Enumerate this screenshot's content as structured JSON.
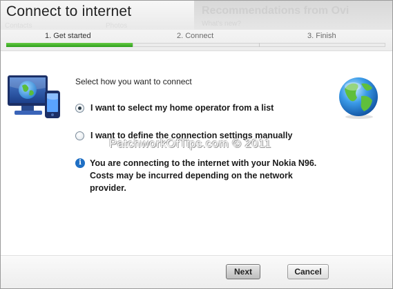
{
  "window": {
    "title": "Connect to internet",
    "background_title": "Recommendations from Ovi",
    "background_subtitle": "What's new?",
    "background_left_subtext_1": "Contacts",
    "background_left_subtext_2": "Photos"
  },
  "steps": {
    "items": [
      {
        "label": "1. Get started",
        "active": true
      },
      {
        "label": "2. Connect",
        "active": false
      },
      {
        "label": "3. Finish",
        "active": false
      }
    ],
    "progress_fraction": 0.333,
    "progress_color": "#3aaa2a"
  },
  "content": {
    "instruction": "Select how you want to connect",
    "options": [
      {
        "label": "I want to select my home operator from a list",
        "selected": true
      },
      {
        "label": "I want to define the connection settings manually",
        "selected": false
      }
    ],
    "info_icon": "info-icon",
    "info_text": "You are connecting to the internet with your Nokia N96. Costs may be incurred depending on the network provider."
  },
  "watermark": "PatchworkOfTips.com © 2011",
  "icons": {
    "left": "computer-phone-globe-icon",
    "right": "globe-icon"
  },
  "buttons": {
    "next": "Next",
    "cancel": "Cancel"
  },
  "colors": {
    "accent_blue": "#1f6fc4",
    "progress_green": "#3aaa2a"
  }
}
